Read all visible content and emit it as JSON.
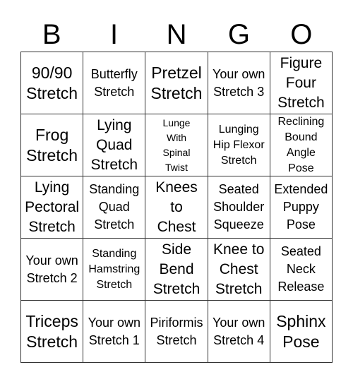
{
  "header": {
    "letters": [
      "B",
      "I",
      "N",
      "G",
      "O"
    ]
  },
  "cells": [
    [
      "90/90\nStretch",
      "Butterfly\nStretch",
      "Pretzel\nStretch",
      "Your own\nStretch 3",
      "Figure\nFour\nStretch"
    ],
    [
      "Frog\nStretch",
      "Lying\nQuad\nStretch",
      "Lunge\nWith\nSpinal\nTwist",
      "Lunging\nHip Flexor\nStretch",
      "Reclining\nBound\nAngle\nPose"
    ],
    [
      "Lying\nPectoral\nStretch",
      "Standing\nQuad\nStretch",
      "Knees\nto\nChest",
      "Seated\nShoulder\nSqueeze",
      "Extended\nPuppy\nPose"
    ],
    [
      "Your own\nStretch 2",
      "Standing\nHamstring\nStretch",
      "Side\nBend\nStretch",
      "Knee to\nChest\nStretch",
      "Seated\nNeck\nRelease"
    ],
    [
      "Triceps\nStretch",
      "Your own\nStretch 1",
      "Piriformis\nStretch",
      "Your own\nStretch 4",
      "Sphinx\nPose"
    ]
  ]
}
